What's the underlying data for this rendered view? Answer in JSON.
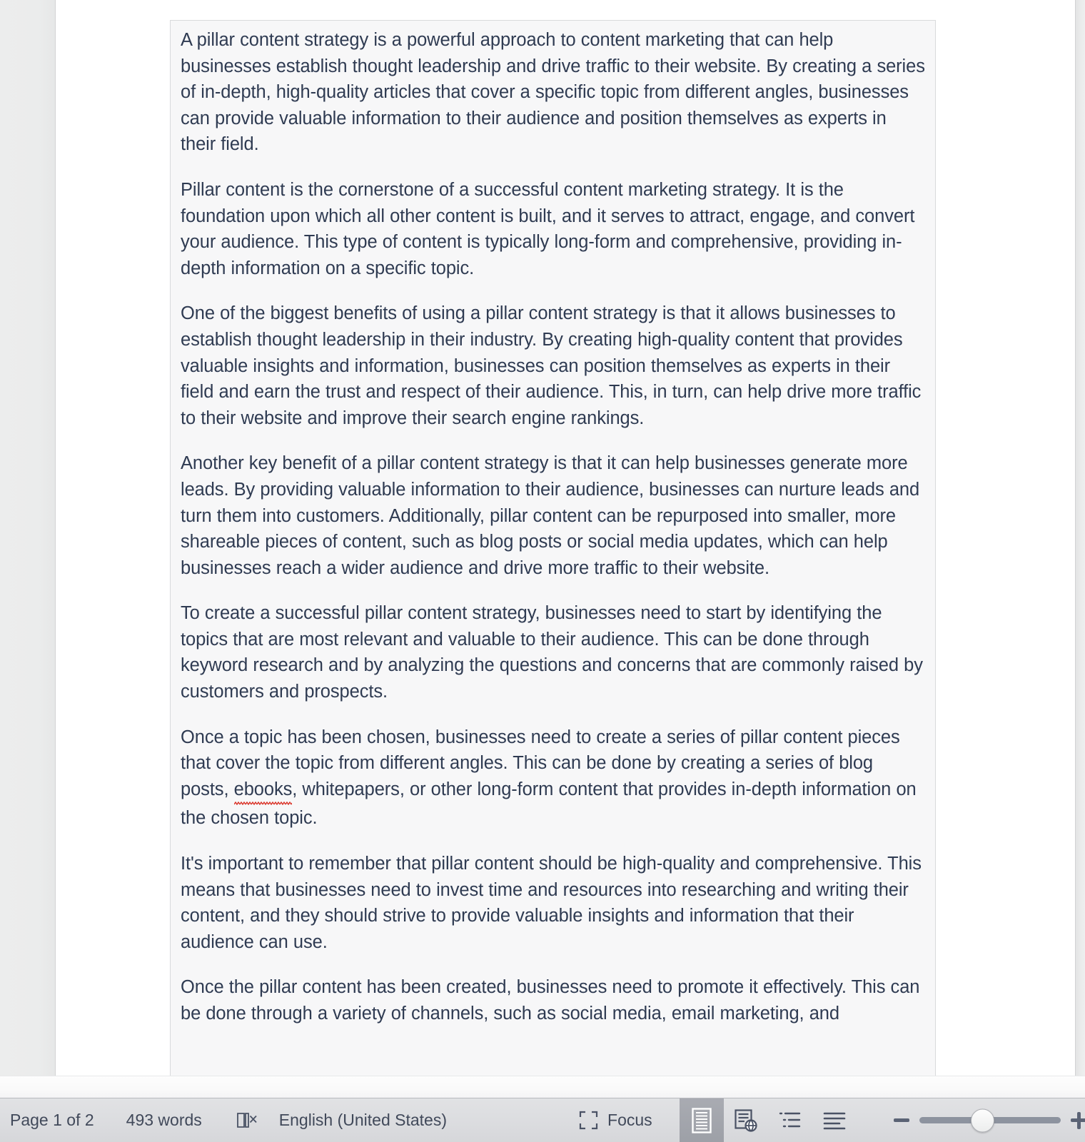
{
  "document": {
    "paragraphs": [
      "A pillar content strategy is a powerful approach to content marketing that can help businesses establish thought leadership and drive traffic to their website. By creating a series of in-depth, high-quality articles that cover a specific topic from different angles, businesses can provide valuable information to their audience and position themselves as experts in their field.",
      "Pillar content is the cornerstone of a successful content marketing strategy. It is the foundation upon which all other content is built, and it serves to attract, engage, and convert your audience. This type of content is typically long-form and comprehensive, providing in-depth information on a specific topic.",
      "One of the biggest benefits of using a pillar content strategy is that it allows businesses to establish thought leadership in their industry. By creating high-quality content that provides valuable insights and information, businesses can position themselves as experts in their field and earn the trust and respect of their audience. This, in turn, can help drive more traffic to their website and improve their search engine rankings.",
      "Another key benefit of a pillar content strategy is that it can help businesses generate more leads. By providing valuable information to their audience, businesses can nurture leads and turn them into customers. Additionally, pillar content can be repurposed into smaller, more shareable pieces of content, such as blog posts or social media updates, which can help businesses reach a wider audience and drive more traffic to their website.",
      "To create a successful pillar content strategy, businesses need to start by identifying the topics that are most relevant and valuable to their audience. This can be done through keyword research and by analyzing the questions and concerns that are commonly raised by customers and prospects.",
      "It's important to remember that pillar content should be high-quality and comprehensive. This means that businesses need to invest time and resources into researching and writing their content, and they should strive to provide valuable insights and information that their audience can use.",
      "Once the pillar content has been created, businesses need to promote it effectively. This can be done through a variety of channels, such as social media, email marketing, and"
    ],
    "paragraph_with_misspelling": {
      "before": "Once a topic has been chosen, businesses need to create a series of pillar content pieces that cover the topic from different angles. This can be done by creating a series of blog posts, ",
      "misspelled_word": "ebooks",
      "after": ", whitepapers, or other long-form content that provides in-depth information on the chosen topic."
    },
    "text_color": "#2f3b52",
    "misspelling_underline_color": "#d93025"
  },
  "status_bar": {
    "page_indicator": "Page 1 of 2",
    "word_count": "493 words",
    "proofing_icon": "proofing-errors-icon",
    "language": "English (United States)",
    "focus_label": "Focus",
    "focus_icon": "focus-mode-icon",
    "view_modes": [
      {
        "name": "print-layout-view",
        "icon": "print-layout-icon",
        "active": true
      },
      {
        "name": "web-layout-view",
        "icon": "web-layout-icon",
        "active": false
      },
      {
        "name": "outline-view",
        "icon": "outline-icon",
        "active": false
      },
      {
        "name": "draft-view",
        "icon": "draft-icon",
        "active": false
      }
    ],
    "zoom": {
      "decrease_icon": "zoom-out-icon",
      "increase_icon": "zoom-in-icon",
      "slider_name": "zoom-slider"
    }
  },
  "colors": {
    "page_background": "#ffffff",
    "gutter": "#ebecec",
    "statusbar": "#dcdde0",
    "textframe_fill": "#f7f7f8",
    "textframe_border": "#d9dadc",
    "active_view_highlight": "#a1a4ab"
  }
}
